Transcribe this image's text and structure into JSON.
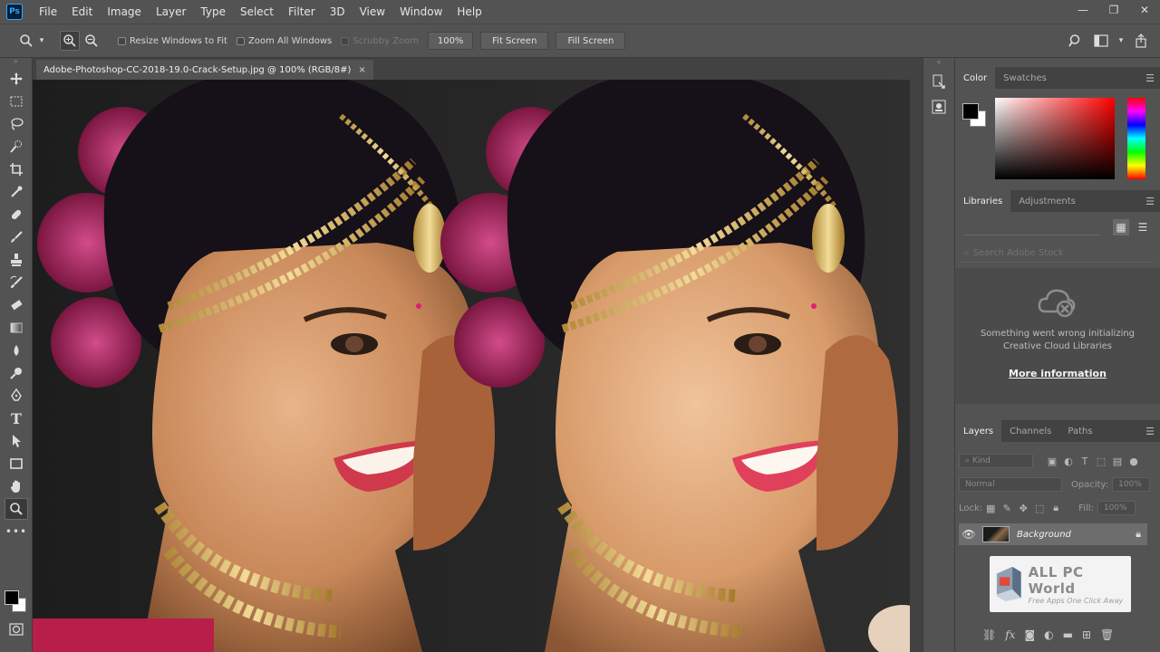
{
  "app": {
    "logo_text": "Ps"
  },
  "menu": [
    "File",
    "Edit",
    "Image",
    "Layer",
    "Type",
    "Select",
    "Filter",
    "3D",
    "View",
    "Window",
    "Help"
  ],
  "window_controls": {
    "minimize": "—",
    "restore": "❐",
    "close": "✕"
  },
  "options_bar": {
    "resize_windows": "Resize Windows to Fit",
    "zoom_all": "Zoom All Windows",
    "scrubby_zoom": "Scrubby Zoom",
    "zoom_value": "100%",
    "fit_screen": "Fit Screen",
    "fill_screen": "Fill Screen"
  },
  "document": {
    "tab_title": "Adobe-Photoshop-CC-2018-19.0-Crack-Setup.jpg @ 100% (RGB/8#)",
    "close": "×"
  },
  "panels": {
    "color": {
      "tabs": [
        "Color",
        "Swatches"
      ],
      "foreground": "#000000",
      "background": "#ffffff"
    },
    "libraries": {
      "tabs": [
        "Libraries",
        "Adjustments"
      ],
      "search_placeholder": "Search Adobe Stock",
      "error_line1": "Something went wrong initializing",
      "error_line2": "Creative Cloud Libraries",
      "more_info": "More information"
    },
    "layers": {
      "tabs": [
        "Layers",
        "Channels",
        "Paths"
      ],
      "filter": "Kind",
      "blend_mode": "Normal",
      "opacity_label": "Opacity:",
      "opacity_value": "100%",
      "lock_label": "Lock:",
      "fill_label": "Fill:",
      "fill_value": "100%",
      "layer_name": "Background"
    }
  },
  "watermark": {
    "title": "ALL PC World",
    "subtitle": "Free Apps One Click Away"
  }
}
